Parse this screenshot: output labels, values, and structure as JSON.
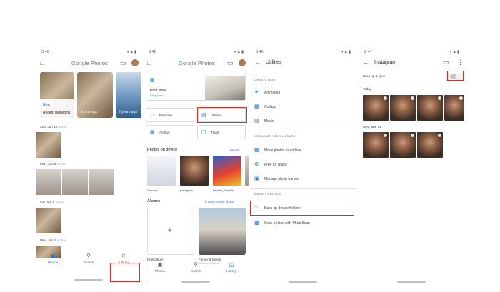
{
  "screen1": {
    "status_time": "3:46",
    "status_icons": "▾▲▮",
    "app_logo": {
      "G": "G",
      "o1": "o",
      "o2": "o",
      "g": "g",
      "l": "l",
      "e": "e",
      "word": " Photos"
    },
    "highlights": [
      {
        "label_top": "New",
        "label_bottom": "Recent highlights"
      },
      {
        "label": "1 year ago"
      },
      {
        "label": "2 years ago"
      }
    ],
    "sections": [
      {
        "date": "Sun, Jun 14",
        "place": "Home"
      },
      {
        "date": "Mon, Jun 8",
        "place": "Home"
      },
      {
        "date": "Sat, Jun 6",
        "place": "Home"
      },
      {
        "date": "Wed, Jun 3",
        "place": "Home"
      }
    ],
    "nav": {
      "photos": "Photos",
      "search": "Search",
      "library": "Library"
    }
  },
  "screen2": {
    "status_time": "3:46",
    "status_icons": "▾▲▮",
    "print_store": {
      "title": "Print store",
      "link": "Shop now"
    },
    "utility_buttons": {
      "favorites": "Favorites",
      "utilities": "Utilities",
      "archive": "Archive",
      "trash": "Trash"
    },
    "photos_on_device": {
      "header": "Photos on device",
      "view_all": "View all",
      "folders": [
        "Camera",
        "Instagram",
        "Named_Baserts"
      ]
    },
    "albums": {
      "header": "Albums",
      "sort": "Most recent photo",
      "new_album": "New album",
      "family_title": "Family & friends",
      "family_sub": "350 items • Shared"
    },
    "nav": {
      "photos": "Photos",
      "search": "Search",
      "library": "Library"
    }
  },
  "screen3": {
    "status_time": "3:46",
    "status_icons": "▾▲▮",
    "title": "Utilities",
    "create_new": {
      "header": "CREATE NEW",
      "items": [
        "Animation",
        "Collage",
        "Movie"
      ]
    },
    "organize": {
      "header": "ORGANIZE YOUR LIBRARY",
      "items": [
        "Move photos to archive",
        "Free up space",
        "Manage photo frames"
      ]
    },
    "import": {
      "header": "IMPORT PHOTOS",
      "items": [
        "Back up device folders",
        "Scan photos with PhotoScan"
      ]
    }
  },
  "screen4": {
    "status_time": "2:47",
    "status_icons": "▾▲▮",
    "title": "Instagram",
    "backup_label": "Back up & sync",
    "groups": [
      {
        "label": "Today"
      },
      {
        "label": "Wed, Mar 11"
      }
    ]
  }
}
